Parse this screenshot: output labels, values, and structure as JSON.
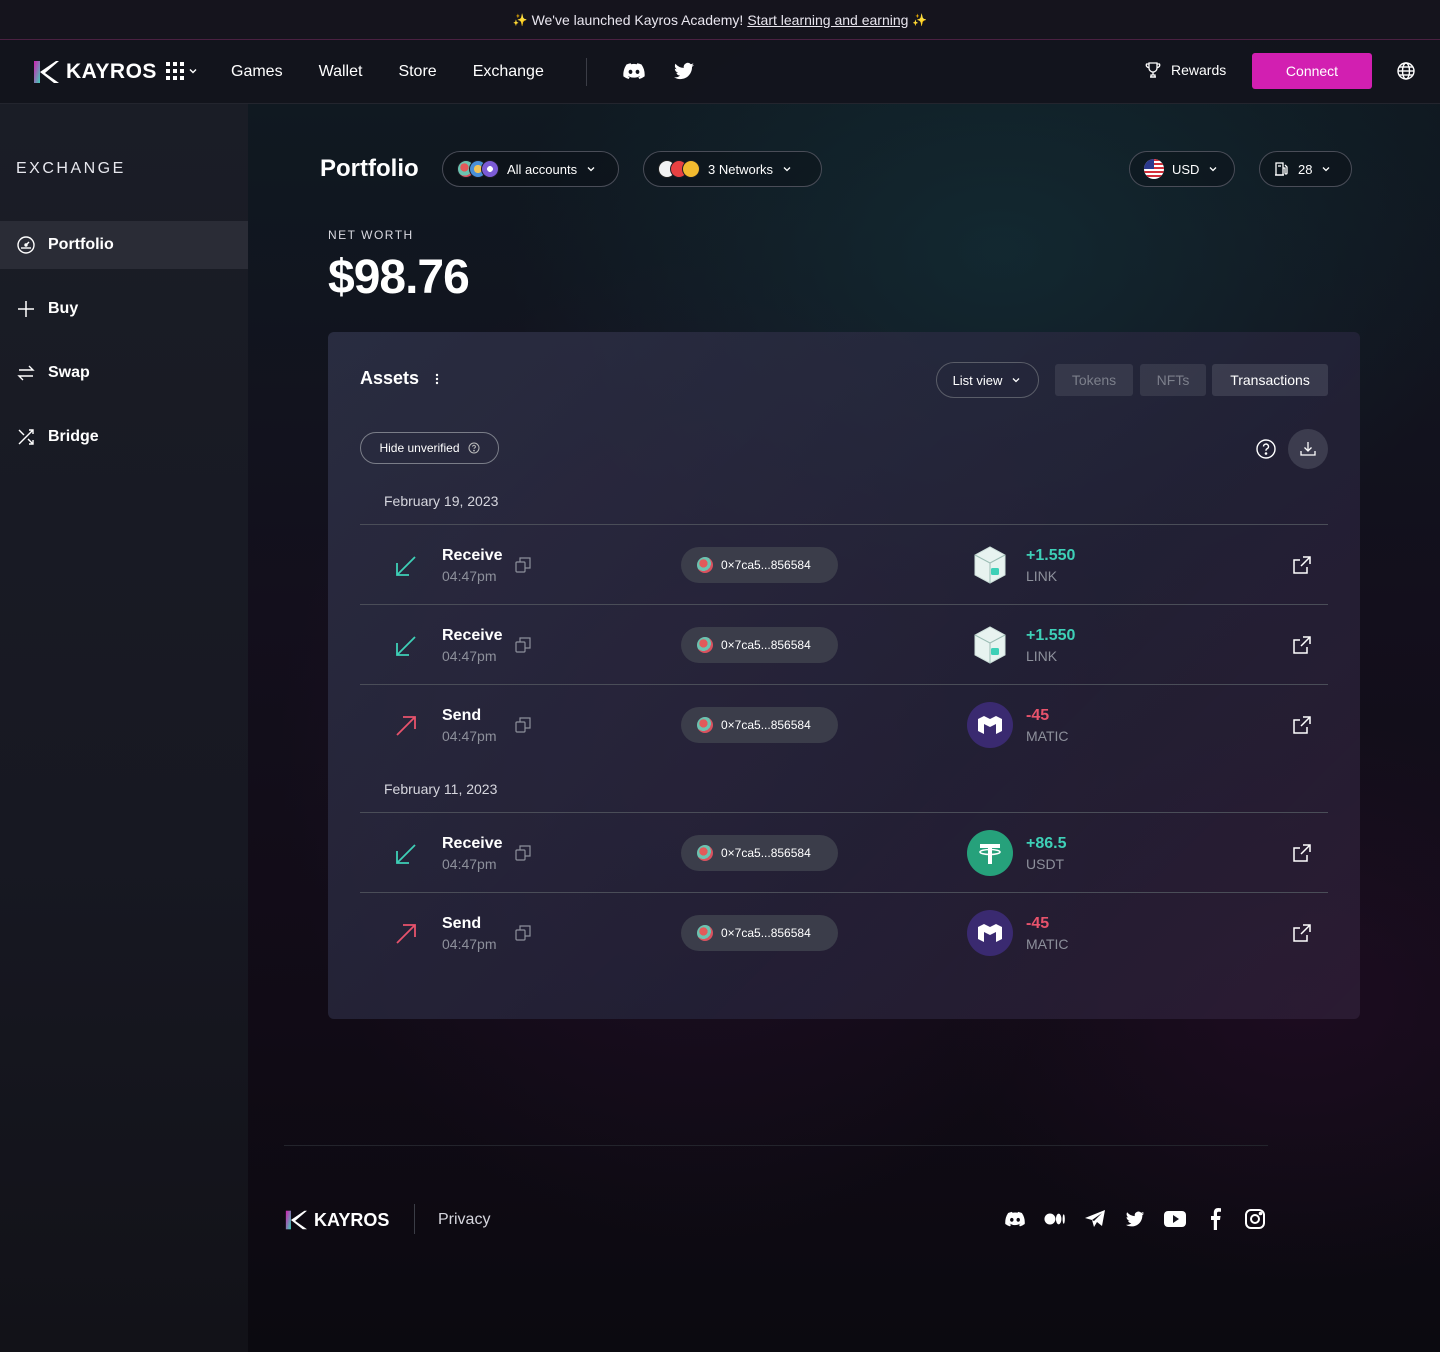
{
  "announcement": {
    "text": "We've launched Kayros Academy!",
    "link": "Start learning and earning"
  },
  "navbar": {
    "brand": "KAYROS",
    "links": [
      "Games",
      "Wallet",
      "Store",
      "Exchange"
    ],
    "rewards": "Rewards",
    "connect": "Connect"
  },
  "sidebar": {
    "title": "EXCHANGE",
    "items": [
      {
        "label": "Portfolio",
        "icon": "gauge-icon",
        "active": true
      },
      {
        "label": "Buy",
        "icon": "plus-icon",
        "active": false
      },
      {
        "label": "Swap",
        "icon": "swap-icon",
        "active": false
      },
      {
        "label": "Bridge",
        "icon": "shuffle-icon",
        "active": false
      }
    ]
  },
  "header": {
    "title": "Portfolio",
    "accounts": "All accounts",
    "networks": "3 Networks",
    "currency": "USD",
    "gas": "28"
  },
  "networth": {
    "label": "NET WORTH",
    "value": "$98.76"
  },
  "assets": {
    "title": "Assets",
    "list_view": "List view",
    "tabs": [
      "Tokens",
      "NFTs",
      "Transactions"
    ],
    "active_tab": "Transactions",
    "hide_unverified": "Hide unverified",
    "groups": [
      {
        "date": "February 19, 2023",
        "transactions": [
          {
            "type": "Receive",
            "time": "04:47pm",
            "address": "0×7ca5...856584",
            "amount": "+1.550",
            "symbol": "LINK",
            "direction": "in"
          },
          {
            "type": "Receive",
            "time": "04:47pm",
            "address": "0×7ca5...856584",
            "amount": "+1.550",
            "symbol": "LINK",
            "direction": "in"
          },
          {
            "type": "Send",
            "time": "04:47pm",
            "address": "0×7ca5...856584",
            "amount": "-45",
            "symbol": "MATIC",
            "direction": "out"
          }
        ]
      },
      {
        "date": "February 11, 2023",
        "transactions": [
          {
            "type": "Receive",
            "time": "04:47pm",
            "address": "0×7ca5...856584",
            "amount": "+86.5",
            "symbol": "USDT",
            "direction": "in"
          },
          {
            "type": "Send",
            "time": "04:47pm",
            "address": "0×7ca5...856584",
            "amount": "-45",
            "symbol": "MATIC",
            "direction": "out"
          }
        ]
      }
    ]
  },
  "footer": {
    "brand": "KAYROS",
    "privacy": "Privacy",
    "social": [
      "discord-icon",
      "medium-icon",
      "telegram-icon",
      "twitter-icon",
      "youtube-icon",
      "facebook-icon",
      "instagram-icon"
    ]
  },
  "colors": {
    "accent": "#d21fb1",
    "positive": "#3ed0b7",
    "negative": "#e8536c"
  }
}
